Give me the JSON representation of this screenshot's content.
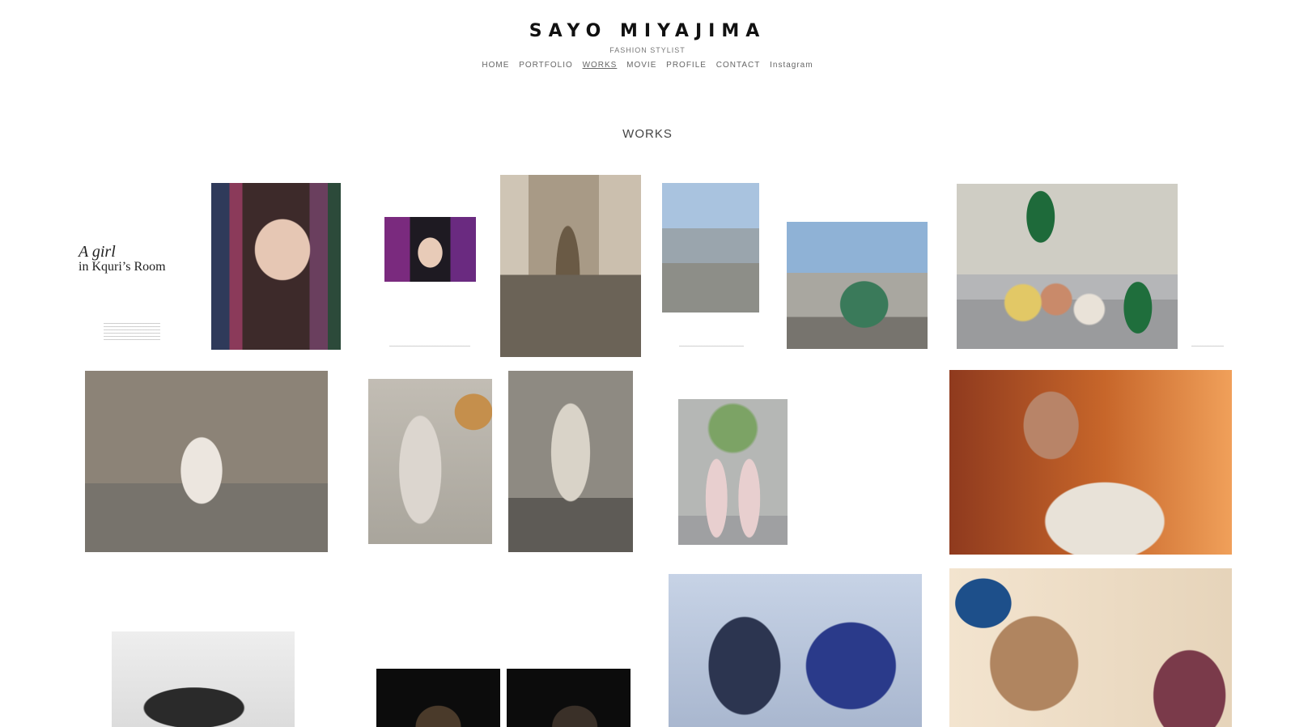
{
  "site": {
    "title": "SAYO MIYAJIMA",
    "subtitle": "FASHION STYLIST"
  },
  "nav": {
    "home": "HOME",
    "portfolio": "PORTFOLIO",
    "works": "WORKS",
    "movie": "MOVIE",
    "profile": "PROFILE",
    "contact": "CONTACT",
    "instagram": "Instagram"
  },
  "page": {
    "title": "WORKS"
  },
  "article": {
    "title_line1": "A girl",
    "title_line2": "in Kquri’s Room"
  }
}
